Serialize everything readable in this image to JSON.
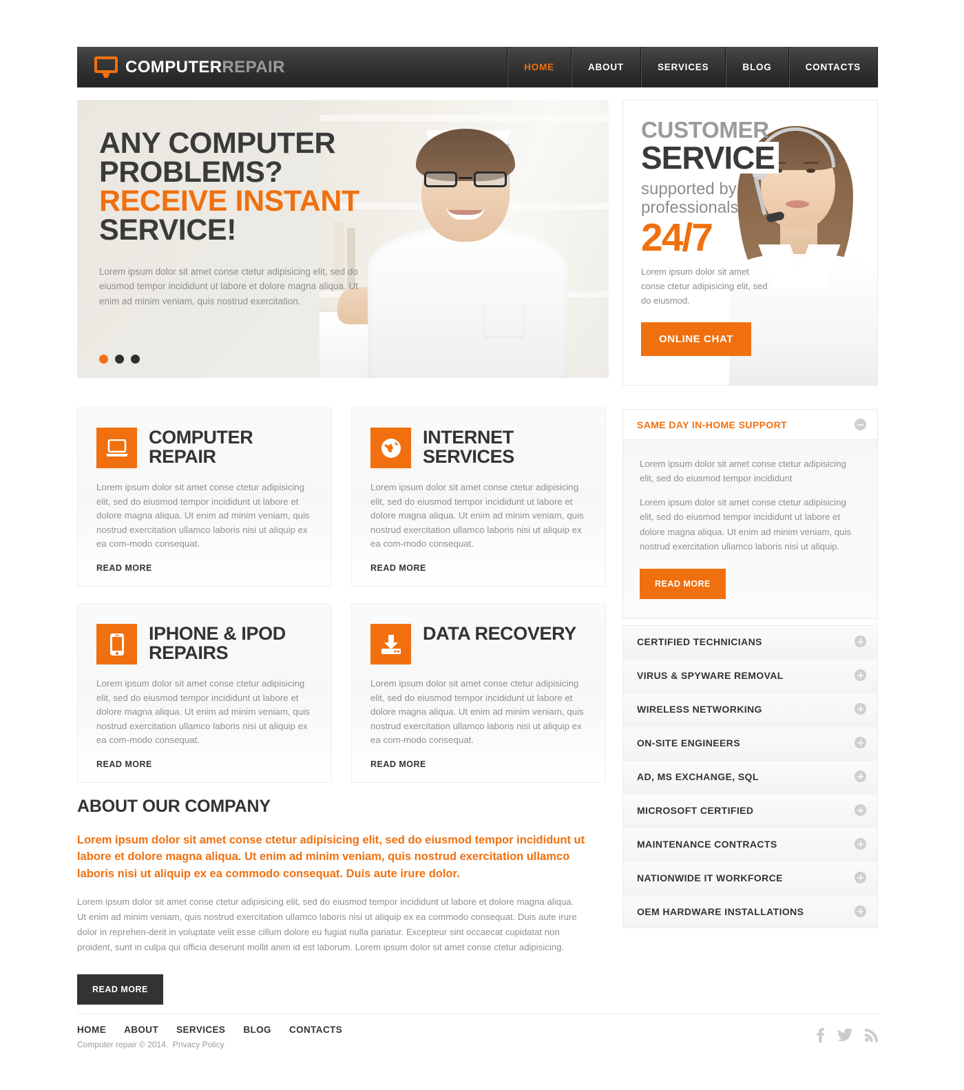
{
  "brand": {
    "part1": "COMPUTER",
    "part2": "REPAIR",
    "logo_icon": "monitor-icon"
  },
  "nav": {
    "items": [
      {
        "label": "HOME",
        "active": true
      },
      {
        "label": "ABOUT",
        "active": false
      },
      {
        "label": "SERVICES",
        "active": false
      },
      {
        "label": "BLOG",
        "active": false
      },
      {
        "label": "CONTACTS",
        "active": false
      }
    ]
  },
  "hero": {
    "line1": "ANY COMPUTER",
    "line2": "PROBLEMS?",
    "line3": "RECEIVE INSTANT",
    "line4": "SERVICE!",
    "paragraph": "Lorem ipsum dolor sit amet conse ctetur adipisicing elit, sed do eiusmod tempor incididunt ut labore et dolore magna aliqua. Ut enim ad minim veniam, quis nostrud exercitation.",
    "dots": [
      {
        "active": true
      },
      {
        "active": false
      },
      {
        "active": false
      }
    ]
  },
  "customer_service": {
    "heading_top": "CUSTOMER",
    "heading_main": "SERVICE",
    "subheading": "supported by professionals",
    "big_number": "24/7",
    "paragraph": "Lorem ipsum dolor sit amet conse ctetur adipisicing elit, sed do eiusmod.",
    "button_label": "ONLINE CHAT"
  },
  "services": {
    "read_more": "READ MORE",
    "body_text": "Lorem ipsum dolor sit amet conse ctetur adipisicing elit, sed do eiusmod tempor incididunt ut labore et dolore magna aliqua. Ut enim ad minim veniam, quis nostrud exercitation ullamco laboris nisi ut aliquip ex ea com-modo consequat.",
    "cards": [
      {
        "title": "COMPUTER REPAIR",
        "icon": "laptop-icon"
      },
      {
        "title": "INTERNET SERVICES",
        "icon": "globe-icon"
      },
      {
        "title": "IPHONE & IPOD REPAIRS",
        "icon": "smartphone-icon"
      },
      {
        "title": "DATA RECOVERY",
        "icon": "data-recovery-icon"
      }
    ]
  },
  "accordion": {
    "open_item": {
      "title": "SAME DAY IN-HOME SUPPORT",
      "paragraph1": "Lorem ipsum dolor sit amet conse ctetur adipisicing elit, sed do eiusmod tempor incididunt",
      "paragraph2": "Lorem ipsum dolor sit amet conse ctetur adipisicing elit, sed do eiusmod tempor incididunt ut labore et dolore magna aliqua. Ut enim ad minim veniam, quis nostrud exercitation ullamco laboris nisi ut aliquip.",
      "button_label": "READ MORE",
      "toggle_icon": "minus-circle-icon"
    },
    "items": [
      {
        "title": "CERTIFIED TECHNICIANS",
        "toggle_icon": "plus-circle-icon"
      },
      {
        "title": "VIRUS & SPYWARE REMOVAL",
        "toggle_icon": "plus-circle-icon"
      },
      {
        "title": "WIRELESS NETWORKING",
        "toggle_icon": "plus-circle-icon"
      },
      {
        "title": "ON-SITE ENGINEERS",
        "toggle_icon": "plus-circle-icon"
      },
      {
        "title": "AD, MS EXCHANGE, SQL",
        "toggle_icon": "plus-circle-icon"
      },
      {
        "title": "MICROSOFT CERTIFIED",
        "toggle_icon": "plus-circle-icon"
      },
      {
        "title": "MAINTENANCE CONTRACTS",
        "toggle_icon": "plus-circle-icon"
      },
      {
        "title": "NATIONWIDE IT WORKFORCE",
        "toggle_icon": "plus-circle-icon"
      },
      {
        "title": "OEM HARDWARE INSTALLATIONS",
        "toggle_icon": "plus-circle-icon"
      }
    ]
  },
  "about": {
    "heading": "ABOUT OUR COMPANY",
    "lead": "Lorem ipsum dolor sit amet conse ctetur adipisicing elit, sed do eiusmod tempor incididunt ut labore et dolore magna aliqua. Ut enim ad minim veniam, quis nostrud exercitation ullamco laboris nisi ut aliquip ex ea commodo consequat. Duis aute irure dolor.",
    "paragraph": "Lorem ipsum dolor sit amet conse ctetur adipisicing elit, sed do eiusmod tempor incididunt ut labore et dolore magna aliqua. Ut enim ad minim veniam, quis nostrud exercitation ullamco laboris nisi ut aliquip ex ea commodo consequat. Duis aute irure dolor in reprehen-derit in voluptate velit esse cillum dolore eu fugiat nulla pariatur. Excepteur sint occaecat cupidatat non proident, sunt in culpa qui officia deserunt mollit anim id est laborum. Lorem ipsum dolor sit amet conse ctetur adipisicing.",
    "button_label": "READ MORE"
  },
  "footer": {
    "nav": [
      {
        "label": "HOME"
      },
      {
        "label": "ABOUT"
      },
      {
        "label": "SERVICES"
      },
      {
        "label": "BLOG"
      },
      {
        "label": "CONTACTS"
      }
    ],
    "copyright": "Computer repair © 2014.",
    "privacy_label": "Privacy Policy",
    "social": [
      {
        "name": "facebook-icon"
      },
      {
        "name": "twitter-icon"
      },
      {
        "name": "rss-icon"
      }
    ]
  },
  "colors": {
    "accent": "#f0700f",
    "dark": "#333333",
    "muted": "#8f8f8f"
  }
}
